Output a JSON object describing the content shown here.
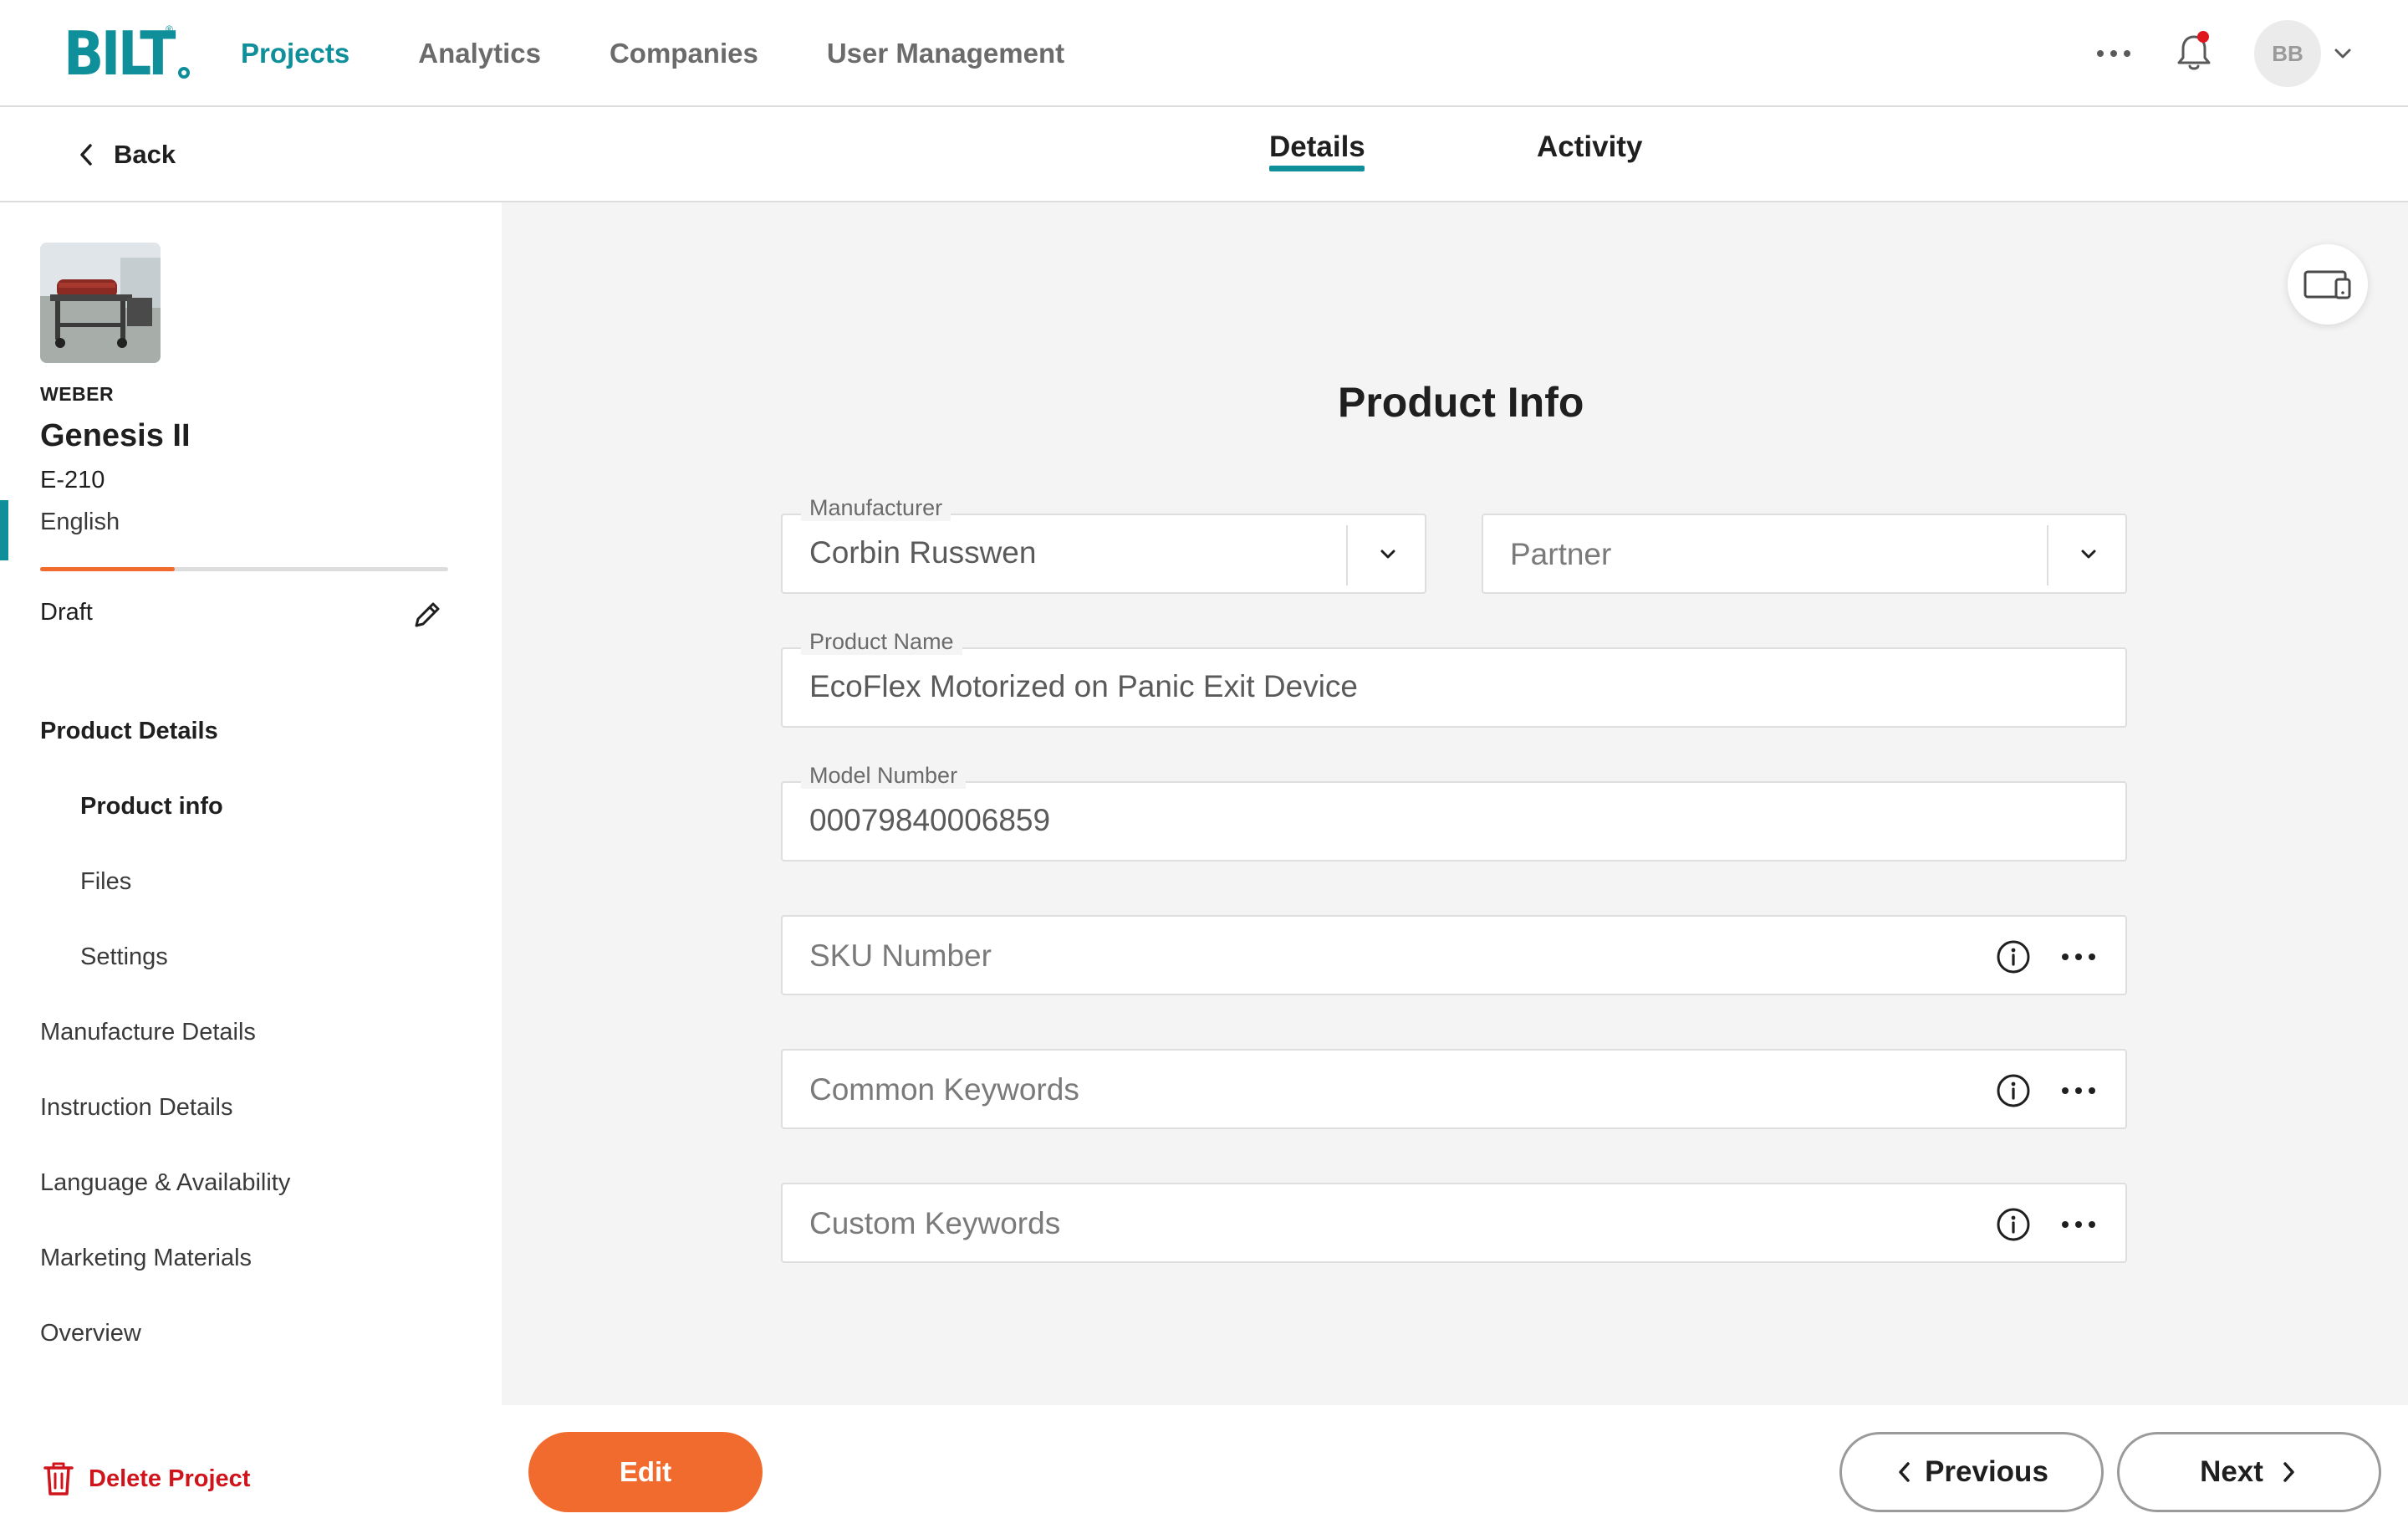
{
  "app": {
    "logo_text": "BILT",
    "logo_reg": "®",
    "brand_color": "#0f8f9a",
    "accent_color": "#f26b2e"
  },
  "nav": {
    "links": [
      {
        "label": "Projects",
        "active": true
      },
      {
        "label": "Analytics",
        "active": false
      },
      {
        "label": "Companies",
        "active": false
      },
      {
        "label": "User Management",
        "active": false
      }
    ],
    "more_icon": "more-horizontal-icon",
    "notifications_icon": "bell-icon",
    "notification_dot_color": "#e0161e",
    "avatar_initials": "BB"
  },
  "subheader": {
    "back_label": "Back",
    "tabs": [
      {
        "label": "Details",
        "active": true
      },
      {
        "label": "Activity",
        "active": false
      }
    ]
  },
  "sidebar": {
    "brand": "WEBER",
    "product_title": "Genesis II",
    "model": "E-210",
    "language": "English",
    "progress_fraction": 0.33,
    "status": "Draft",
    "nav": [
      {
        "label": "Product Details",
        "level": 0,
        "active": true
      },
      {
        "label": "Product info",
        "level": 1,
        "active": true
      },
      {
        "label": "Files",
        "level": 1,
        "active": false
      },
      {
        "label": "Settings",
        "level": 1,
        "active": false
      },
      {
        "label": "Manufacture Details",
        "level": 0,
        "active": false
      },
      {
        "label": "Instruction Details",
        "level": 0,
        "active": false
      },
      {
        "label": "Language & Availability",
        "level": 0,
        "active": false
      },
      {
        "label": "Marketing Materials",
        "level": 0,
        "active": false
      },
      {
        "label": "Overview",
        "level": 0,
        "active": false
      }
    ],
    "delete_label": "Delete Project"
  },
  "form": {
    "title": "Product Info",
    "manufacturer": {
      "label": "Manufacturer",
      "value": "Corbin Russwen"
    },
    "partner": {
      "placeholder": "Partner"
    },
    "product_name": {
      "label": "Product Name",
      "value": "EcoFlex Motorized on Panic Exit Device"
    },
    "model_number": {
      "label": "Model Number",
      "value": "00079840006859"
    },
    "sku_number": {
      "placeholder": "SKU Number"
    },
    "common_keywords": {
      "placeholder": "Common Keywords"
    },
    "custom_keywords": {
      "placeholder": "Custom Keywords"
    }
  },
  "footer": {
    "edit_label": "Edit",
    "previous_label": "Previous",
    "next_label": "Next"
  }
}
